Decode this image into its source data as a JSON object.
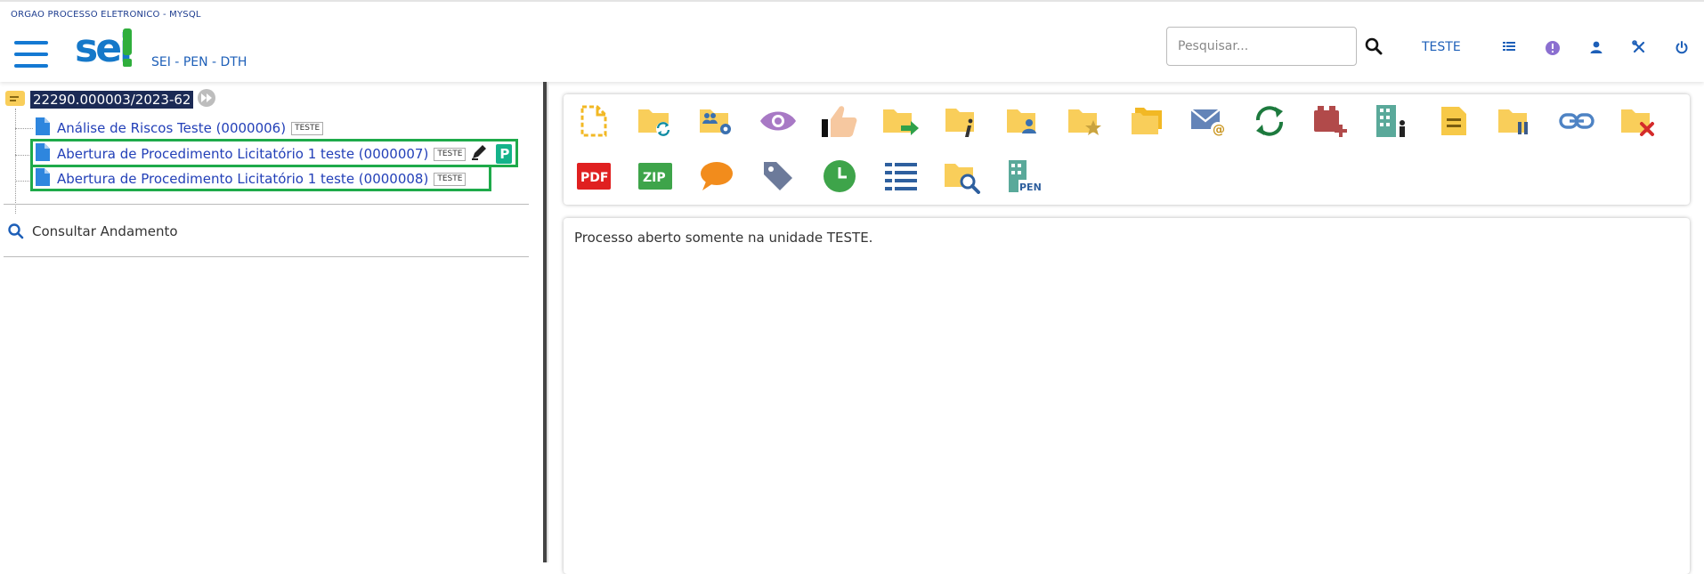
{
  "header": {
    "org_name": "ORGAO PROCESSO ELETRONICO - MYSQL",
    "logo_text": "sei",
    "system_subtitle": "SEI - PEN - DTH",
    "search_placeholder": "Pesquisar...",
    "unit": "TESTE"
  },
  "tree": {
    "process_number": "22290.000003/2023-62",
    "documents": [
      {
        "label": "Análise de Riscos Teste (0000006)",
        "unit": "TESTE"
      },
      {
        "label": "Abertura de Procedimento Licitatório 1 teste (0000007)",
        "unit": "TESTE",
        "p_badge": "P"
      },
      {
        "label": "Abertura de Procedimento Licitatório 1 teste (0000008)",
        "unit": "TESTE"
      }
    ],
    "consult_label": "Consultar Andamento"
  },
  "toolbar": {
    "pdf_label": "PDF",
    "zip_label": "ZIP",
    "pen_label": "PEN"
  },
  "content": {
    "message": "Processo aberto somente na unidade TESTE."
  },
  "colors": {
    "primary_blue": "#1479d3",
    "folder_yellow": "#f9ce5a",
    "highlight_green": "#1eaa4a",
    "process_bg": "#1b2a55"
  }
}
